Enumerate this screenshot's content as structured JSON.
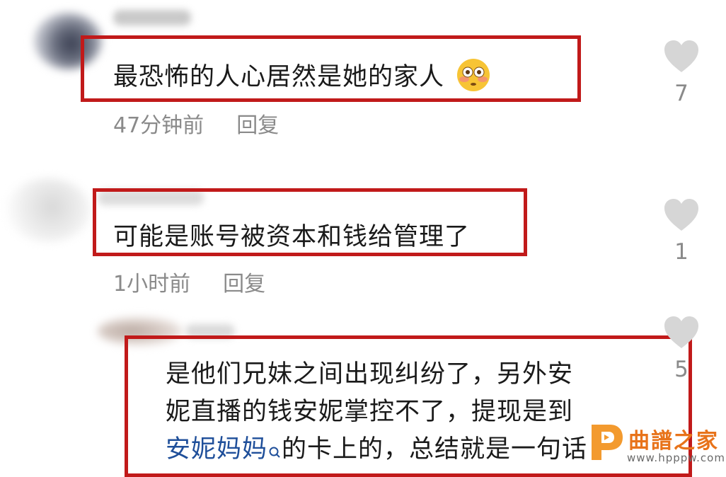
{
  "comments": [
    {
      "text": "最恐怖的人心居然是她的家人",
      "emoji": "flushed-face",
      "time": "47分钟前",
      "reply_label": "回复",
      "likes": "7"
    },
    {
      "text": "可能是账号被资本和钱给管理了",
      "time": "1小时前",
      "reply_label": "回复",
      "likes": "1"
    },
    {
      "line1": "是他们兄妹之间出现纠纷了，另外安",
      "line2": "妮直播的钱安妮掌控不了，提现是到",
      "link_text": "安妮妈妈",
      "line3_rest": "的卡上的，总结就是一句话",
      "likes": "5"
    }
  ],
  "watermark": {
    "name": "曲譜之家",
    "url": "www.hpppw.com"
  },
  "colors": {
    "highlight_border": "#c11a1a",
    "link": "#1f4f9a",
    "meta_gray": "#8a8a8a",
    "heart_gray": "#d6d6d6",
    "watermark_orange": "#e8731a"
  }
}
